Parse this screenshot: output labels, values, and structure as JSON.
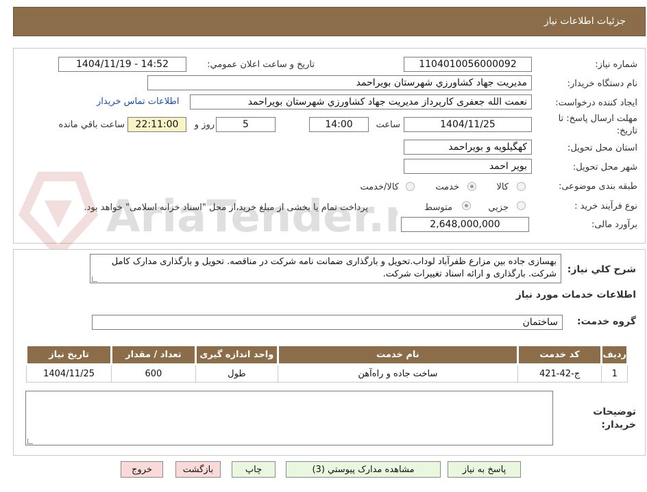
{
  "header": {
    "title": "جزئیات اطلاعات نیاز"
  },
  "watermark": {
    "text": "AriaTender.net"
  },
  "form": {
    "need_number_label": "شماره نیاز:",
    "need_number": "1104010056000092",
    "announce_label": "تاریخ و ساعت اعلان عمومي:",
    "announce_value": "1404/11/19 - 14:52",
    "buyer_org_label": "نام دستگاه خريدار:",
    "buyer_org": "مديريت جهاد کشاورزي شهرستان بويراحمد",
    "requester_label": "ايجاد کننده درخواست:",
    "requester": "نعمت الله جعفری کارپرداز مديريت جهاد کشاورزي شهرستان بويراحمد",
    "contact_link": "اطلاعات تماس خريدار",
    "deadline_label_1": "مهلت ارسال پاسخ: تا",
    "deadline_label_2": "تاريخ:",
    "deadline_date": "1404/11/25",
    "time_label": "ساعت",
    "deadline_time": "14:00",
    "days": "5",
    "days_label": "روز و",
    "remaining": "22:11:00",
    "remaining_label": "ساعت باقي مانده",
    "province_label": "استان محل تحويل:",
    "province": "کهگيلويه و بويراحمد",
    "city_label": "شهر محل تحويل:",
    "city": "بوير احمد",
    "category_label": "طبقه بندی موضوعی:",
    "category_options": [
      "کالا",
      "خدمت",
      "کالا/خدمت"
    ],
    "category_selected": "خدمت",
    "process_label": "نوع فرآیند خرید :",
    "process_options": [
      "جزيي",
      "متوسط"
    ],
    "process_selected": "متوسط",
    "process_note": "پرداخت تمام يا بخشی از مبلغ خريد،از محل \"اسناد خزانه اسلامی\" خواهد بود.",
    "budget_label": "برآورد مالی:",
    "budget": "2,648,000,000"
  },
  "details": {
    "summary_label": "شرح کلي نياز:",
    "summary": "بهسازی جاده بین مزارع ظفرآباد لوداب.تحویل و بارگذاری ضمانت نامه شرکت در مناقصه. تحویل و بارگذاری مدارک کامل شرکت. بارگذاری و ارائه اسناد تغییرات شرکت.",
    "services_title": "اطلاعات خدمات مورد نياز",
    "service_group_label": "گروه خدمت:",
    "service_group": "ساختمان",
    "table": {
      "headers": [
        "رديف",
        "کد خدمت",
        "نام خدمت",
        "واحد اندازه گيری",
        "تعداد / مقدار",
        "تاريخ نياز"
      ],
      "rows": [
        [
          "1",
          "ج-42-421",
          "ساخت جاده و راه‌آهن",
          "طول",
          "600",
          "1404/11/25"
        ]
      ]
    },
    "buyer_notes_label_1": "توضيحات",
    "buyer_notes_label_2": "خريدار:",
    "buyer_notes": ""
  },
  "buttons": {
    "reply": "پاسخ به نياز",
    "attachments": "مشاهده مدارک پيوستي (3)",
    "print": "چاپ",
    "back": "بازگشت",
    "exit": "خروج"
  }
}
